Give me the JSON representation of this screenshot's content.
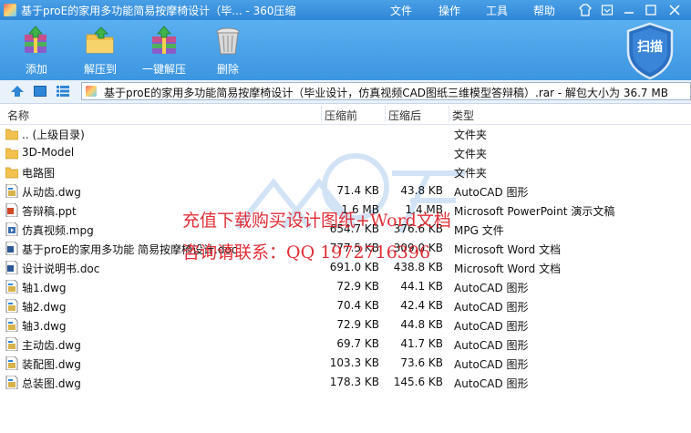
{
  "window": {
    "title": "基于proE的家用多功能简易按摩椅设计（毕... - 360压缩",
    "menu": [
      "文件",
      "操作",
      "工具",
      "帮助"
    ],
    "controls": [
      "☐",
      "—",
      "☐",
      "✕"
    ]
  },
  "toolbar": {
    "buttons": [
      {
        "label": "添加",
        "icon": "add-archive-icon"
      },
      {
        "label": "解压到",
        "icon": "extract-to-icon"
      },
      {
        "label": "一键解压",
        "icon": "one-click-extract-icon"
      },
      {
        "label": "删除",
        "icon": "trash-icon"
      }
    ],
    "scan_label": "扫描"
  },
  "address": {
    "path": "基于proE的家用多功能简易按摩椅设计（毕业设计，仿真视频CAD图纸三维模型答辩稿）.rar - 解包大小为 36.7 MB"
  },
  "columns": {
    "name": "名称",
    "size": "压缩前",
    "packed": "压缩后",
    "type": "类型"
  },
  "files": [
    {
      "name": ".. (上级目录)",
      "size": "",
      "packed": "",
      "type": "文件夹",
      "icon": "folder-icon"
    },
    {
      "name": "3D-Model",
      "size": "",
      "packed": "",
      "type": "文件夹",
      "icon": "folder-icon"
    },
    {
      "name": "电路图",
      "size": "",
      "packed": "",
      "type": "文件夹",
      "icon": "folder-icon"
    },
    {
      "name": "从动齿.dwg",
      "size": "71.4 KB",
      "packed": "43.8 KB",
      "type": "AutoCAD 图形",
      "icon": "dwg-file-icon"
    },
    {
      "name": "答辩稿.ppt",
      "size": "1.6 MB",
      "packed": "1.4 MB",
      "type": "Microsoft PowerPoint 演示文稿",
      "icon": "ppt-file-icon"
    },
    {
      "name": "仿真视频.mpg",
      "size": "654.7 KB",
      "packed": "376.6 KB",
      "type": "MPG 文件",
      "icon": "video-file-icon"
    },
    {
      "name": "基于proE的家用多功能 简易按摩椅设计.doc",
      "size": "777.5 KB",
      "packed": "309.0 KB",
      "type": "Microsoft Word 文档",
      "icon": "doc-file-icon"
    },
    {
      "name": "设计说明书.doc",
      "size": "691.0 KB",
      "packed": "438.8 KB",
      "type": "Microsoft Word 文档",
      "icon": "doc-file-icon"
    },
    {
      "name": "轴1.dwg",
      "size": "72.9 KB",
      "packed": "44.1 KB",
      "type": "AutoCAD 图形",
      "icon": "dwg-file-icon"
    },
    {
      "name": "轴2.dwg",
      "size": "70.4 KB",
      "packed": "42.4 KB",
      "type": "AutoCAD 图形",
      "icon": "dwg-file-icon"
    },
    {
      "name": "轴3.dwg",
      "size": "72.9 KB",
      "packed": "44.8 KB",
      "type": "AutoCAD 图形",
      "icon": "dwg-file-icon"
    },
    {
      "name": "主动齿.dwg",
      "size": "69.7 KB",
      "packed": "41.7 KB",
      "type": "AutoCAD 图形",
      "icon": "dwg-file-icon"
    },
    {
      "name": "装配图.dwg",
      "size": "103.3 KB",
      "packed": "73.6 KB",
      "type": "AutoCAD 图形",
      "icon": "dwg-file-icon"
    },
    {
      "name": "总装图.dwg",
      "size": "178.3 KB",
      "packed": "145.6 KB",
      "type": "AutoCAD 图形",
      "icon": "dwg-file-icon"
    }
  ],
  "watermark": {
    "line1": "充值下载购买设计图纸+Word文档",
    "line2": "咨询请联系：QQ 1972716396"
  },
  "colors": {
    "titlebar": "#2f86d6",
    "toolbar": "#3c95e0",
    "watermark": "#e0242d",
    "folder": "#f2c14e"
  }
}
